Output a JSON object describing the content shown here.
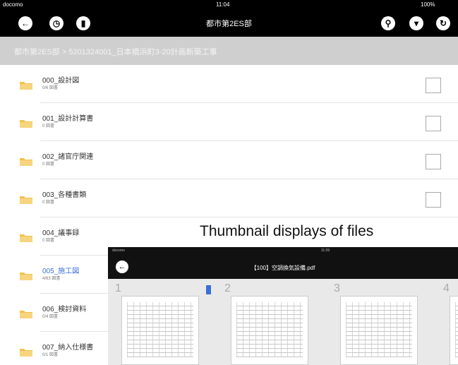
{
  "status": {
    "carrier": "docomo",
    "time": "11:04",
    "battery": "100%"
  },
  "toolbar": {
    "title": "都市第2ES部",
    "icons": [
      "back-icon",
      "clock-icon",
      "bookmark-icon",
      "search-icon",
      "trash-icon",
      "refresh-icon"
    ]
  },
  "breadcrumb": "都市第2ES部 > 5201324001_日本橋浜町3-20計画新築工事",
  "folders": [
    {
      "name": "000_設計図",
      "count": "0/6 図書"
    },
    {
      "name": "001_設計計算書",
      "count": "0 図書"
    },
    {
      "name": "002_諸官庁関連",
      "count": "0 図書"
    },
    {
      "name": "003_各種書類",
      "count": "0 図書"
    },
    {
      "name": "004_議事録",
      "count": "0 図書"
    },
    {
      "name": "005_施工図",
      "count": "4/63 図書"
    },
    {
      "name": "006_検討資料",
      "count": "0/4 図書"
    },
    {
      "name": "007_納入仕様書",
      "count": "0/1 図書"
    }
  ],
  "caption": "Thumbnail displays of files",
  "viewer": {
    "status_carrier": "docomo",
    "status_time": "11:09",
    "title": "【100】空調換気設備.pdf",
    "pages": [
      "1",
      "2",
      "3",
      "4"
    ]
  },
  "colors": {
    "selected": "#3a6fd8",
    "folder": "#f2c14e",
    "bookmark": "#3a6fd8"
  }
}
